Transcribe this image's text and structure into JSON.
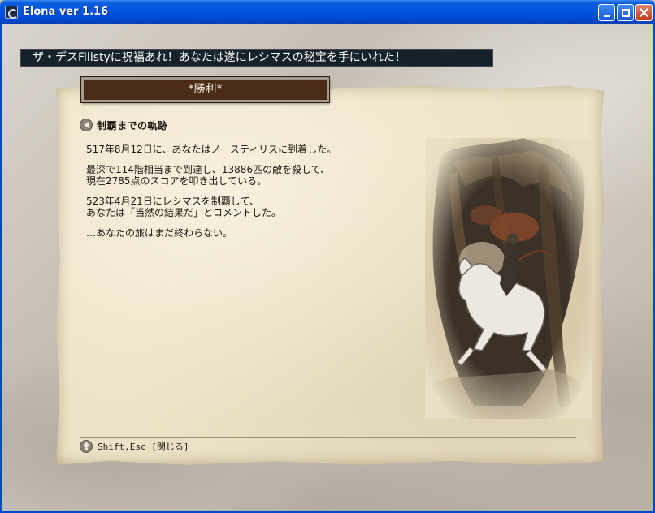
{
  "window": {
    "title": "Elona ver 1.16",
    "buttons": {
      "minimize": "minimize",
      "maximize": "maximize",
      "close": "close"
    }
  },
  "banner": {
    "text": "ザ・デスFilistyに祝福あれ！あなたは遂にレシマスの秘宝を手にいれた！"
  },
  "dialog": {
    "title": "*勝利*",
    "section_title": "制覇までの軌跡",
    "paragraphs": [
      {
        "lines": [
          "517年8月12日に、あなたはノースティリスに到着した。"
        ]
      },
      {
        "lines": [
          "最深で114階相当まで到達し、13886匹の敵を殺して、",
          "現在2785点のスコアを叩き出している。"
        ]
      },
      {
        "lines": [
          "523年4月21日にレシマスを制覇して、",
          "あなたは「当然の結果だ」とコメントした。"
        ]
      },
      {
        "lines": [
          "…あなたの旅はまだ終わらない。"
        ]
      }
    ],
    "illustration": "rider-on-white-horse-in-forest-illustration",
    "footer_hint": "Shift,Esc [閉じる]"
  },
  "colors": {
    "titlebar": "#0054e3",
    "banner_bg": "#16222a",
    "parchment": "#ede3c8",
    "header_plate": "#4a2c19",
    "close_button": "#c1391b"
  }
}
